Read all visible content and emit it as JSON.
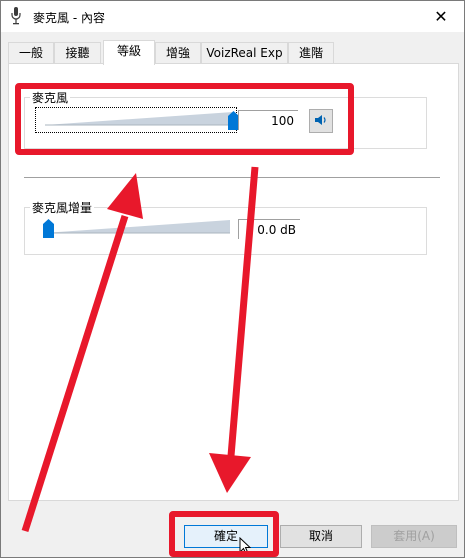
{
  "window": {
    "title": "麥克風 - 內容",
    "title_icon": "microphone-icon",
    "close_glyph": "✕"
  },
  "tabs": [
    {
      "label": "一般",
      "active": false
    },
    {
      "label": "接聽",
      "active": false
    },
    {
      "label": "等級",
      "active": true
    },
    {
      "label": "增強",
      "active": false
    },
    {
      "label": "VoizReal Exp",
      "active": false
    },
    {
      "label": "進階",
      "active": false
    }
  ],
  "levels": {
    "microphone": {
      "label": "麥克風",
      "value": "100",
      "level_percent": 100,
      "speaker_icon": "speaker-icon"
    },
    "boost": {
      "label": "麥克風增量",
      "value": "0.0 dB",
      "level_percent": 0
    }
  },
  "buttons": {
    "ok": "確定",
    "cancel": "取消",
    "apply": "套用(A)"
  },
  "colors": {
    "annotation": "#e8182b",
    "thumb": "#0078d7",
    "wedge": "#c9d3de"
  }
}
